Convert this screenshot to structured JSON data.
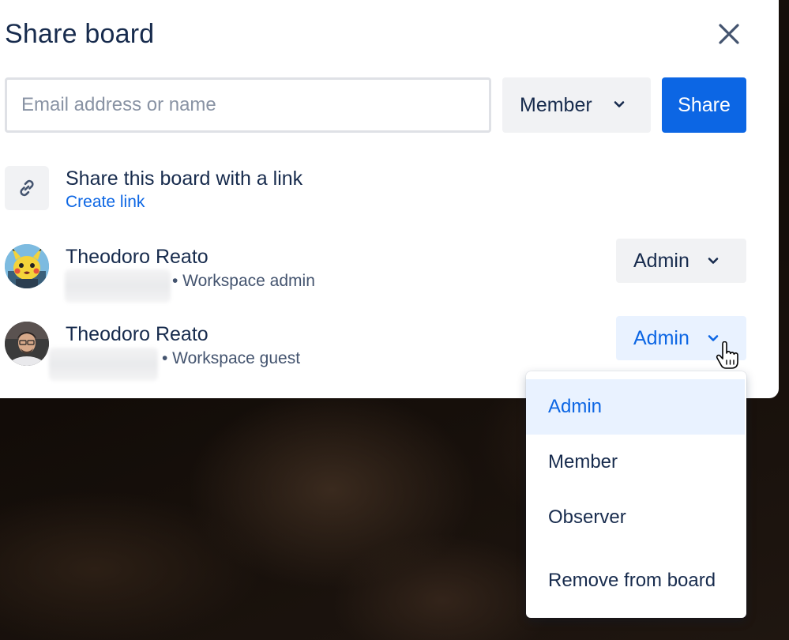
{
  "dialog": {
    "title": "Share board",
    "email_placeholder": "Email address or name",
    "email_value": "",
    "role_selected": "Member",
    "share_label": "Share"
  },
  "link_section": {
    "title": "Share this board with a link",
    "action": "Create link"
  },
  "members": [
    {
      "name": "Theodoro Reato",
      "meta": "• Workspace admin",
      "role": "Admin",
      "avatar": "pikachu-avatar"
    },
    {
      "name": "Theodoro Reato",
      "meta": "• Workspace guest",
      "role": "Admin",
      "avatar": "photo-avatar"
    }
  ],
  "role_menu": {
    "items": [
      "Admin",
      "Member",
      "Observer",
      "Remove from board"
    ],
    "selected": "Admin"
  },
  "colors": {
    "primary": "#0c66e4",
    "text": "#172b4d",
    "subtle_text": "#44546f",
    "neutral_bg": "#f1f2f4",
    "selected_bg": "#e9f2ff"
  }
}
